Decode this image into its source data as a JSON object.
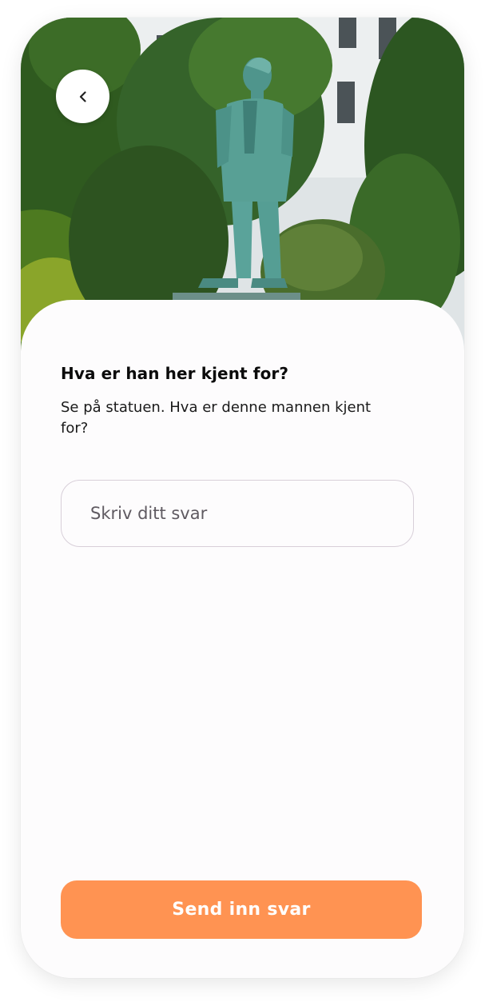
{
  "hero": {
    "image_subject": "bronze-statue-photo"
  },
  "nav": {
    "back_icon": "chevron-left-icon"
  },
  "question": {
    "title": "Hva er han her kjent for?",
    "text": "Se på statuen. Hva er denne mannen kjent for?"
  },
  "answer": {
    "value": "",
    "placeholder": "Skriv ditt svar"
  },
  "submit": {
    "label": "Send inn svar"
  },
  "colors": {
    "accent": "#ff9352",
    "field_border": "#d8cfd9",
    "sheet_background": "#fdfcfd"
  }
}
